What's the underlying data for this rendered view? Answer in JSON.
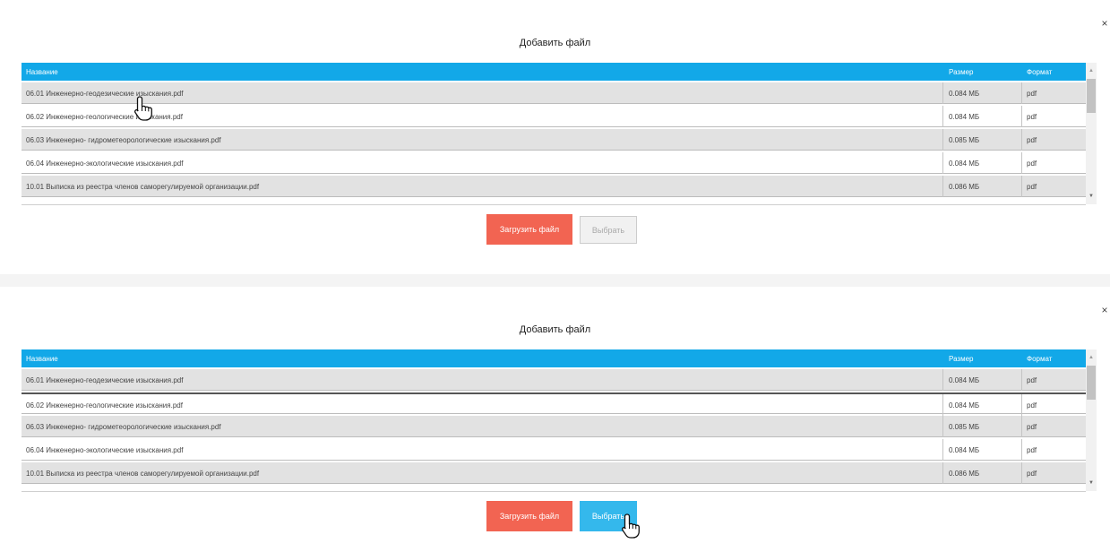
{
  "dialogs": [
    {
      "title": "Добавить файл",
      "close": "×",
      "columns": {
        "name": "Название",
        "size": "Размер",
        "format": "Формат"
      },
      "rows": [
        {
          "name": "06.01 Инженерно-геодезические изыскания.pdf",
          "size": "0.084 МБ",
          "format": "pdf"
        },
        {
          "name": "06.02 Инженерно-геологические изыскания.pdf",
          "size": "0.084 МБ",
          "format": "pdf"
        },
        {
          "name": "06.03 Инженерно- гидрометеорологические изыскания.pdf",
          "size": "0.085 МБ",
          "format": "pdf"
        },
        {
          "name": "06.04 Инженерно-экологические изыскания.pdf",
          "size": "0.084 МБ",
          "format": "pdf"
        },
        {
          "name": "10.01 Выписка из реестра членов саморегулируемой организации.pdf",
          "size": "0.086 МБ",
          "format": "pdf"
        }
      ],
      "buttons": {
        "upload": "Загрузить файл",
        "select": "Выбрать"
      },
      "select_enabled": false
    },
    {
      "title": "Добавить файл",
      "close": "×",
      "columns": {
        "name": "Название",
        "size": "Размер",
        "format": "Формат"
      },
      "rows": [
        {
          "name": "06.01 Инженерно-геодезические изыскания.pdf",
          "size": "0.084 МБ",
          "format": "pdf"
        },
        {
          "name": "06.02 Инженерно-геологические изыскания.pdf",
          "size": "0.084 МБ",
          "format": "pdf"
        },
        {
          "name": "06.03 Инженерно- гидрометеорологические изыскания.pdf",
          "size": "0.085 МБ",
          "format": "pdf"
        },
        {
          "name": "06.04 Инженерно-экологические изыскания.pdf",
          "size": "0.084 МБ",
          "format": "pdf"
        },
        {
          "name": "10.01 Выписка из реестра членов саморегулируемой организации.pdf",
          "size": "0.086 МБ",
          "format": "pdf"
        }
      ],
      "buttons": {
        "upload": "Загрузить файл",
        "select": "Выбрать"
      },
      "select_enabled": true
    }
  ],
  "colors": {
    "header_blue": "#12a8e8",
    "upload_red": "#f26452",
    "select_active_blue": "#34b8ec",
    "select_disabled_gray": "#f1f1f1"
  },
  "icons": {
    "cursor": "hand-pointer-icon",
    "close": "close-icon"
  }
}
